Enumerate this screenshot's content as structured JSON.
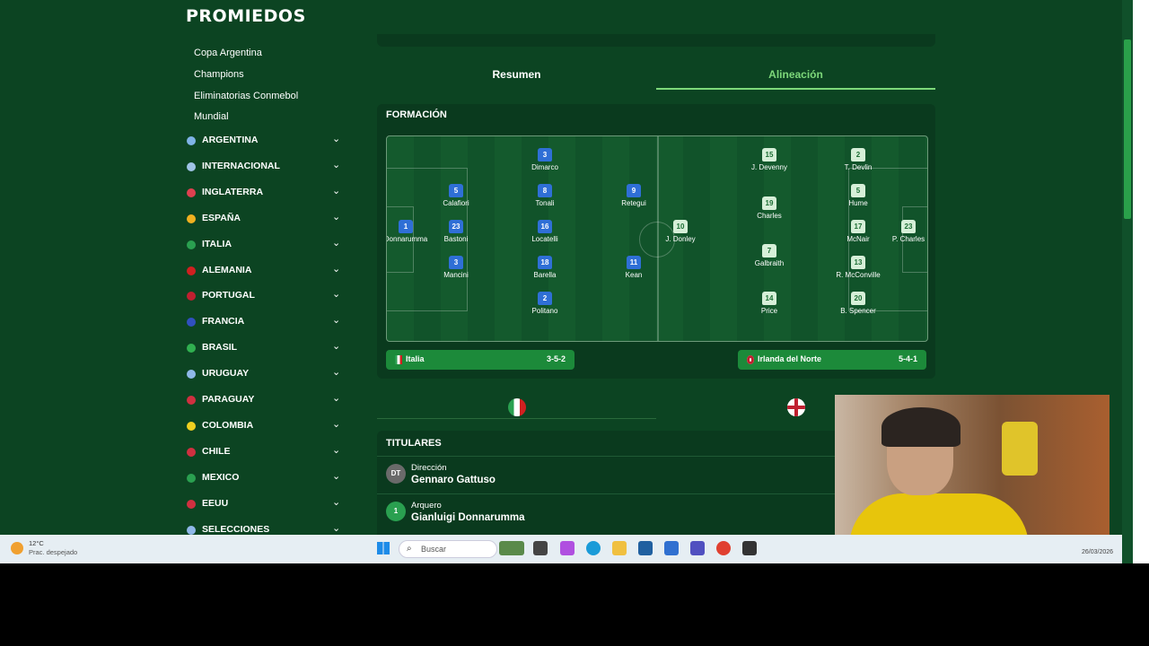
{
  "app": {
    "logo": "PROMIEDOS"
  },
  "sidebar": {
    "sub_items": [
      "Copa Argentina",
      "Champions",
      "Eliminatorias Conmebol",
      "Mundial"
    ],
    "categories": [
      {
        "label": "ARGENTINA",
        "color": "#7fb3e6"
      },
      {
        "label": "INTERNACIONAL",
        "color": "#9fc3e6"
      },
      {
        "label": "INGLATERRA",
        "color": "#e04050"
      },
      {
        "label": "ESPAÑA",
        "color": "#f0b020"
      },
      {
        "label": "ITALIA",
        "color": "#2aa050"
      },
      {
        "label": "ALEMANIA",
        "color": "#d02020"
      },
      {
        "label": "PORTUGAL",
        "color": "#c02030"
      },
      {
        "label": "FRANCIA",
        "color": "#3050c0"
      },
      {
        "label": "BRASIL",
        "color": "#30b050"
      },
      {
        "label": "URUGUAY",
        "color": "#8fb8e8"
      },
      {
        "label": "PARAGUAY",
        "color": "#d03040"
      },
      {
        "label": "COLOMBIA",
        "color": "#f0d020"
      },
      {
        "label": "CHILE",
        "color": "#d03040"
      },
      {
        "label": "MEXICO",
        "color": "#2aa050"
      },
      {
        "label": "EEUU",
        "color": "#d03040"
      },
      {
        "label": "SELECCIONES",
        "color": "#8fb8e8"
      }
    ]
  },
  "tabs": {
    "resumen": "Resumen",
    "alineacion": "Alineación"
  },
  "formation": {
    "title": "FORMACIÓN",
    "italy_players": [
      {
        "num": "1",
        "name": "Donnarumma"
      },
      {
        "num": "5",
        "name": "Calafiori"
      },
      {
        "num": "23",
        "name": "Bastoni"
      },
      {
        "num": "3",
        "name": "Mancini"
      },
      {
        "num": "3",
        "name": "Dimarco"
      },
      {
        "num": "8",
        "name": "Tonali"
      },
      {
        "num": "16",
        "name": "Locatelli"
      },
      {
        "num": "18",
        "name": "Barella"
      },
      {
        "num": "2",
        "name": "Politano"
      },
      {
        "num": "9",
        "name": "Retegui"
      },
      {
        "num": "11",
        "name": "Kean"
      }
    ],
    "nir_players": [
      {
        "num": "10",
        "name": "J. Donley"
      },
      {
        "num": "15",
        "name": "J. Devenny"
      },
      {
        "num": "19",
        "name": "Charles"
      },
      {
        "num": "7",
        "name": "Galbraith"
      },
      {
        "num": "14",
        "name": "Price"
      },
      {
        "num": "2",
        "name": "T. Devlin"
      },
      {
        "num": "5",
        "name": "Hume"
      },
      {
        "num": "17",
        "name": "McNair"
      },
      {
        "num": "13",
        "name": "R. McConville"
      },
      {
        "num": "20",
        "name": "B. Spencer"
      },
      {
        "num": "23",
        "name": "P. Charles"
      }
    ],
    "home_team": "Italia",
    "home_formation": "3-5-2",
    "away_team": "Irlanda del Norte",
    "away_formation": "5-4-1"
  },
  "titulares": {
    "title": "TITULARES",
    "rows": [
      {
        "badge": "DT",
        "role": "Dirección",
        "person": "Gennaro Gattuso"
      },
      {
        "badge": "1",
        "role": "Arquero",
        "person": "Gianluigi Donnarumma"
      }
    ]
  },
  "taskbar": {
    "temp": "12°C",
    "weather": "Prac. despejado",
    "search_placeholder": "Buscar",
    "date": "26/03/2026"
  }
}
